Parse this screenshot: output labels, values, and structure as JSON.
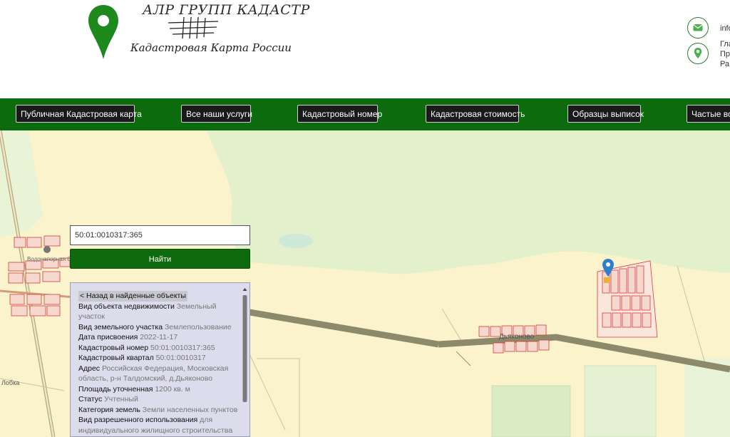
{
  "header": {
    "logo_title": "АЛР ГРУПП КАДАСТР",
    "logo_subtitle": "Кадастровая Карта России",
    "contact_email": "info",
    "address_lines": [
      "Гла",
      "Пр",
      "Ра"
    ]
  },
  "nav": {
    "items": [
      {
        "label": "Публичная Кадастровая карта"
      },
      {
        "label": "Все наши услуги"
      },
      {
        "label": "Кадастровый номер"
      },
      {
        "label": "Кадастровая стоимость"
      },
      {
        "label": "Образцы выписок"
      },
      {
        "label": "Частые вопросы"
      }
    ]
  },
  "search": {
    "value": "50:01:0010317:365",
    "button_label": "Найти"
  },
  "map": {
    "labels": {
      "water_tower": "Водонапорная башня",
      "village": "Дьяконово",
      "road": "Лобка"
    }
  },
  "info": {
    "back_label": "< Назад в найденные объекты",
    "rows": [
      {
        "label": "Вид объекта недвижимости",
        "value": "Земельный участок"
      },
      {
        "label": "Вид земельного участка",
        "value": "Землепользование"
      },
      {
        "label": "Дата присвоения",
        "value": "2022-11-17"
      },
      {
        "label": "Кадастровый номер",
        "value": "50:01:0010317:365"
      },
      {
        "label": "Кадастровый квартал",
        "value": "50:01:0010317"
      },
      {
        "label": "Адрес",
        "value": "Российская Федерация, Московская область, р-н Талдомский, д.Дьяконово"
      },
      {
        "label": "Площадь уточненная",
        "value": "1200 кв. м"
      },
      {
        "label": "Статус",
        "value": "Учтенный"
      },
      {
        "label": "Категория земель",
        "value": "Земли населенных пунктов"
      },
      {
        "label": "Вид разрешенного использования",
        "value": "для индивидуального жилищного строительства"
      }
    ]
  },
  "colors": {
    "brand_green": "#0c6b0c",
    "map_land": "#fbf3cc",
    "map_forest": "#e2f1cc",
    "parcel_stroke": "#d23c3c",
    "marker": "#2d7fd0"
  }
}
